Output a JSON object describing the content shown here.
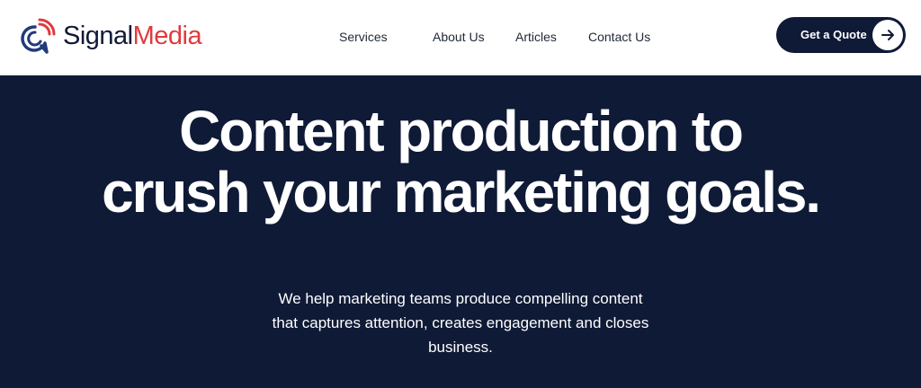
{
  "header": {
    "logo": {
      "part1": "Signal",
      "part2": "Media",
      "icon": "signal-speech-bubble-icon"
    },
    "nav": [
      {
        "label": "Services"
      },
      {
        "label": "About Us"
      },
      {
        "label": "Articles"
      },
      {
        "label": "Contact Us"
      }
    ],
    "cta": {
      "label": "Get a Quote",
      "icon": "arrow-right-icon"
    }
  },
  "hero": {
    "title": "Content production to crush your marketing goals.",
    "subtitle": "We help marketing teams produce compelling content that captures attention, creates engagement and closes business."
  },
  "colors": {
    "navy": "#0f1a36",
    "brand_red": "#e03a3e",
    "white": "#ffffff"
  }
}
